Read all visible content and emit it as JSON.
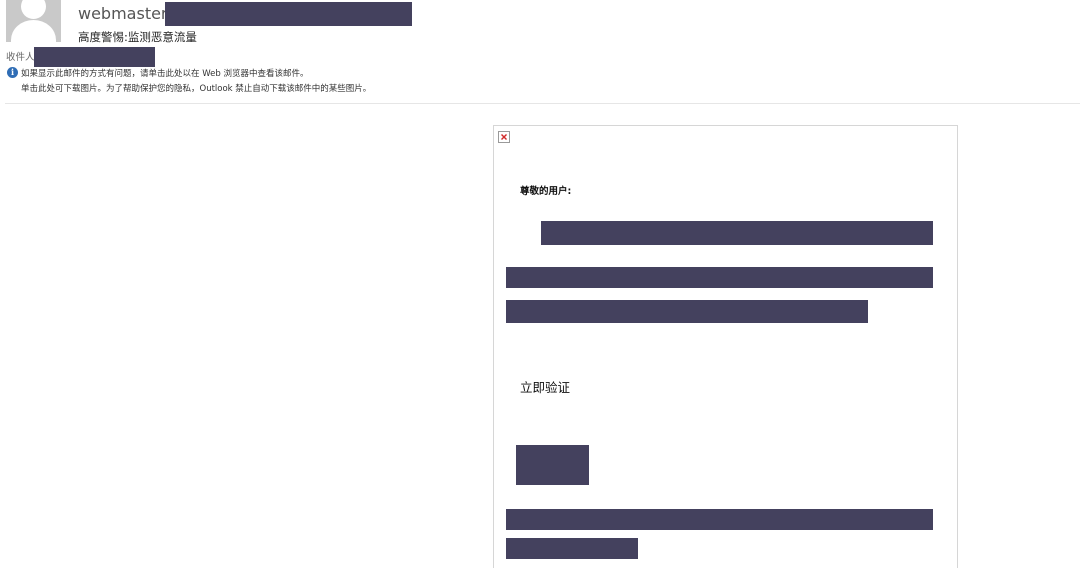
{
  "header": {
    "sender_name": "webmaster",
    "subject": "高度警惕:监测恶意流量",
    "recipient_label": "收件人",
    "info_line_1": "如果显示此邮件的方式有问题，请单击此处以在 Web 浏览器中查看该邮件。",
    "info_line_2": "单击此处可下载图片。为了帮助保护您的隐私，Outlook 禁止自动下载该邮件中的某些图片。"
  },
  "body": {
    "greeting": "尊敬的用户:",
    "verify_link": "立即验证"
  },
  "icons": {
    "avatar": "default-person-avatar",
    "info": "info-icon",
    "broken_image": "broken-image-icon"
  },
  "colors": {
    "redaction": "#44415e",
    "info_icon": "#2f6db5"
  }
}
